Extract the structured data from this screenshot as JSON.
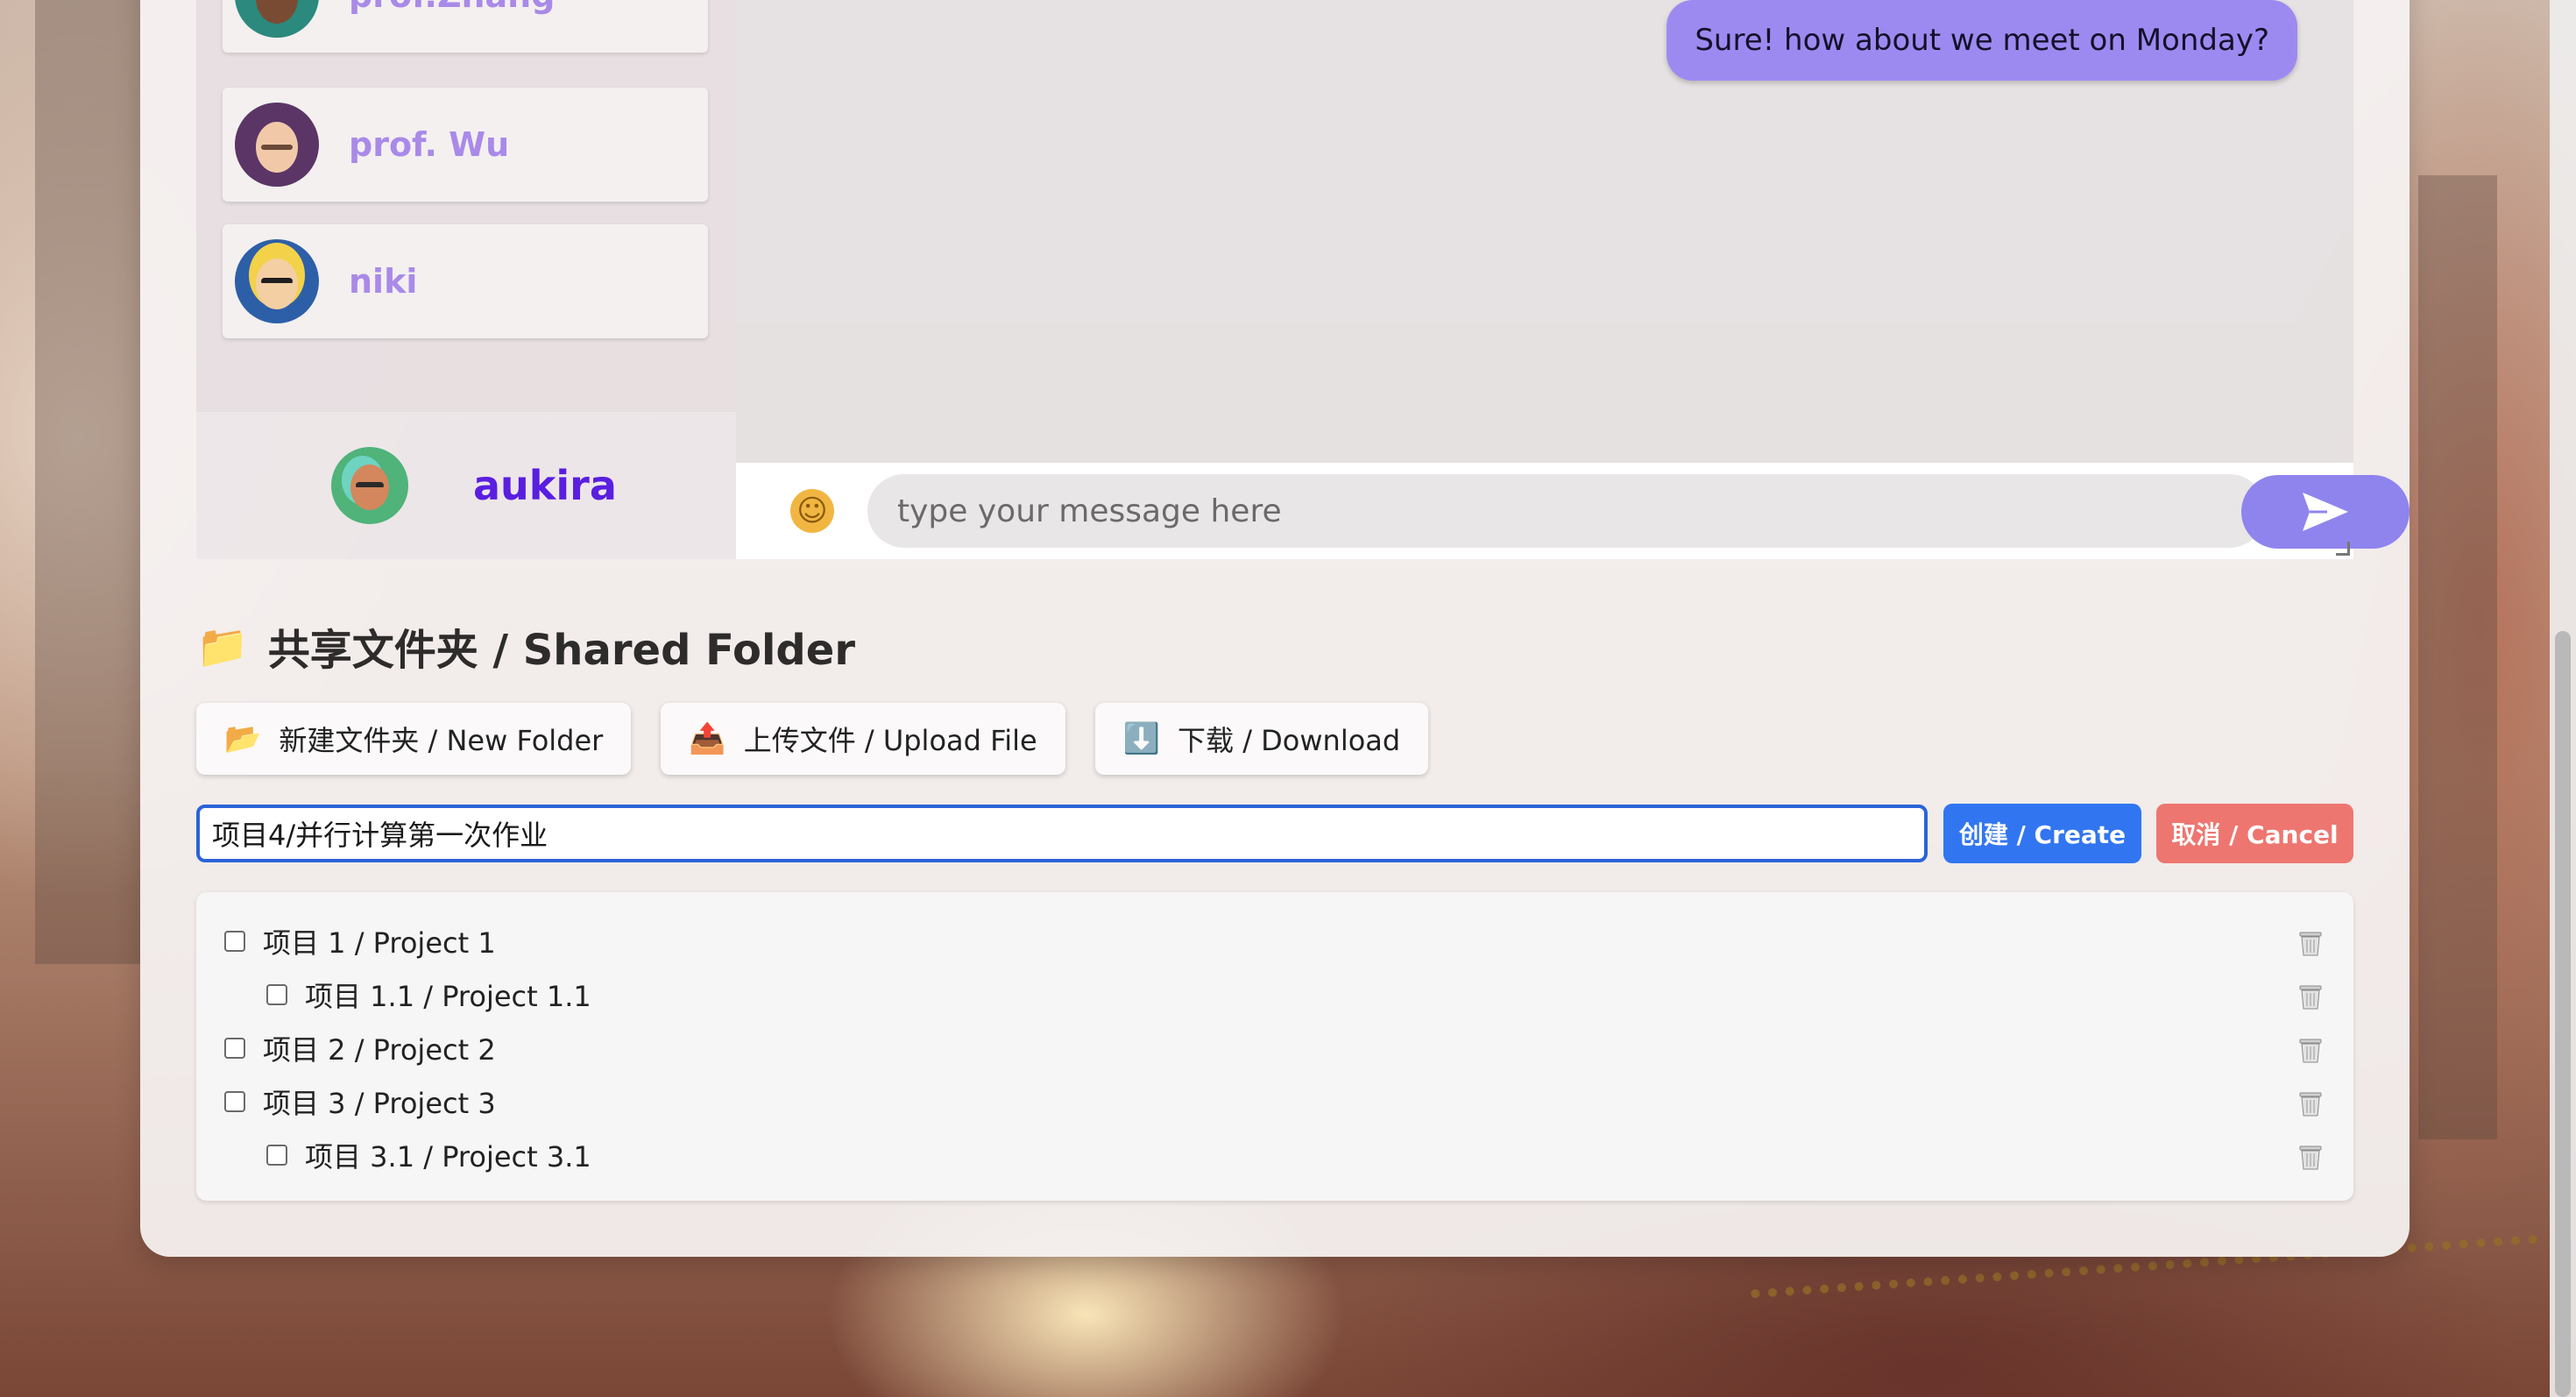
{
  "contacts": [
    {
      "name": "prof.Zhang",
      "avatar_icon": "avatar-prof-zhang",
      "skin": "#7a4b33",
      "bg": "#2b8a7d"
    },
    {
      "name": "prof. Wu",
      "avatar_icon": "avatar-prof-wu",
      "skin": "#f2c9a8",
      "bg": "#5a3566"
    },
    {
      "name": "niki",
      "avatar_icon": "avatar-niki",
      "skin": "#f3cfa3",
      "bg": "#2d5fa8"
    }
  ],
  "current_user": {
    "name": "aukira",
    "avatar_icon": "avatar-aukira"
  },
  "chat": {
    "messages": [
      {
        "text": "Sure! how about we meet on Monday?",
        "from": "me"
      }
    ],
    "input_placeholder": "type your message here",
    "emoji_icon": "smiley-icon",
    "send_icon": "send-arrow-icon"
  },
  "shared_folder": {
    "icon": "📁",
    "title": "共享文件夹 / Shared Folder",
    "buttons": {
      "new_folder": {
        "icon": "📂",
        "label": "新建文件夹 / New Folder"
      },
      "upload": {
        "icon": "📤",
        "label": "上传文件 / Upload File"
      },
      "download": {
        "icon": "⬇️",
        "label": "下载 / Download"
      }
    },
    "path_input_value": "项目4/并行计算第一次作业",
    "create_label": "创建 / Create",
    "cancel_label": "取消 / Cancel",
    "items": [
      {
        "label": "项目 1 / Project 1",
        "level": 0,
        "checked": false
      },
      {
        "label": "项目 1.1 / Project 1.1",
        "level": 1,
        "checked": false
      },
      {
        "label": "项目 2 / Project 2",
        "level": 0,
        "checked": false
      },
      {
        "label": "项目 3 / Project 3",
        "level": 0,
        "checked": false
      },
      {
        "label": "项目 3.1 / Project 3.1",
        "level": 1,
        "checked": false
      }
    ]
  },
  "colors": {
    "accent_purple": "#9d8af0",
    "create_blue": "#3176f0",
    "cancel_red": "#ee7670",
    "contact_name": "#a98ae8",
    "self_name": "#5a1ee0"
  }
}
